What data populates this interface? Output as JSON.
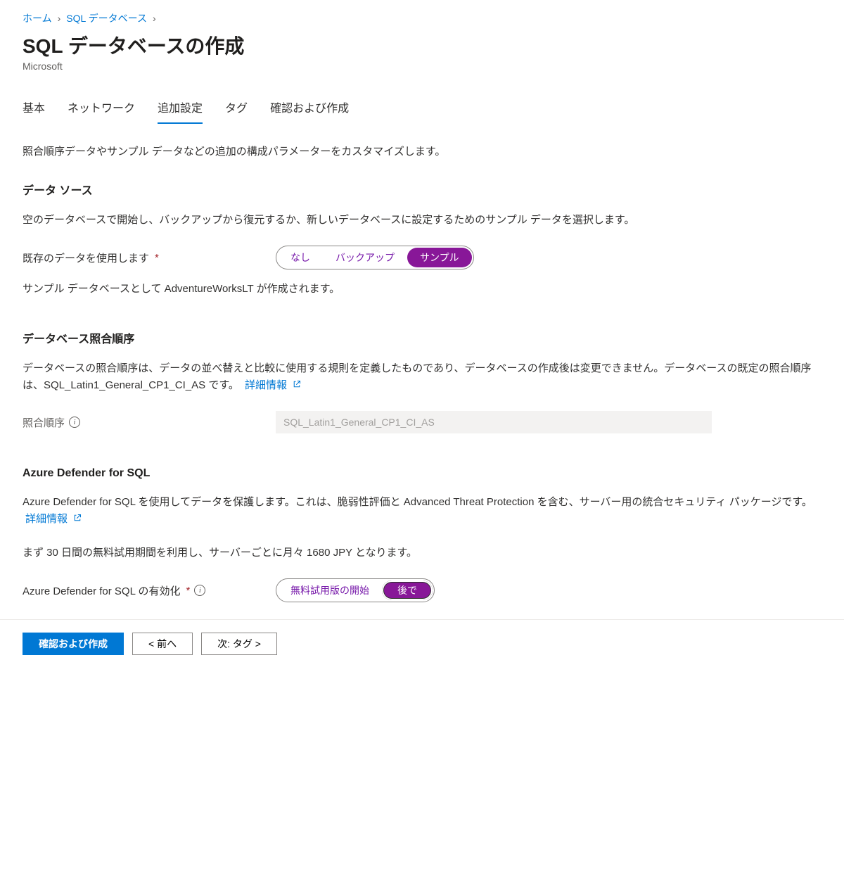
{
  "breadcrumb": {
    "home": "ホーム",
    "db": "SQL データベース"
  },
  "title": "SQL データベースの作成",
  "subtitle": "Microsoft",
  "tabs": {
    "basic": "基本",
    "network": "ネットワーク",
    "advanced": "追加設定",
    "tags": "タグ",
    "review": "確認および作成"
  },
  "intro": "照合順序データやサンプル データなどの追加の構成パラメーターをカスタマイズします。",
  "data_source": {
    "heading": "データ ソース",
    "desc": "空のデータベースで開始し、バックアップから復元するか、新しいデータベースに設定するためのサンプル データを選択します。",
    "field_label": "既存のデータを使用します",
    "options": {
      "none": "なし",
      "backup": "バックアップ",
      "sample": "サンプル"
    },
    "note": "サンプル データベースとして AdventureWorksLT が作成されます。"
  },
  "collation": {
    "heading": "データベース照合順序",
    "desc": "データベースの照合順序は、データの並べ替えと比較に使用する規則を定義したものであり、データベースの作成後は変更できません。データベースの既定の照合順序は、SQL_Latin1_General_CP1_CI_AS です。",
    "link": "詳細情報",
    "field_label": "照合順序",
    "value": "SQL_Latin1_General_CP1_CI_AS"
  },
  "defender": {
    "heading": "Azure Defender for SQL",
    "desc": "Azure Defender for SQL を使用してデータを保護します。これは、脆弱性評価と Advanced Threat Protection を含む、サーバー用の統合セキュリティ パッケージです。",
    "link": "詳細情報",
    "trial_note": "まず 30 日間の無料試用期間を利用し、サーバーごとに月々 1680 JPY となります。",
    "field_label": "Azure Defender for SQL の有効化",
    "options": {
      "start": "無料試用版の開始",
      "later": "後で"
    }
  },
  "footer": {
    "review": "確認および作成",
    "prev": "< 前へ",
    "next": "次: タグ >"
  }
}
